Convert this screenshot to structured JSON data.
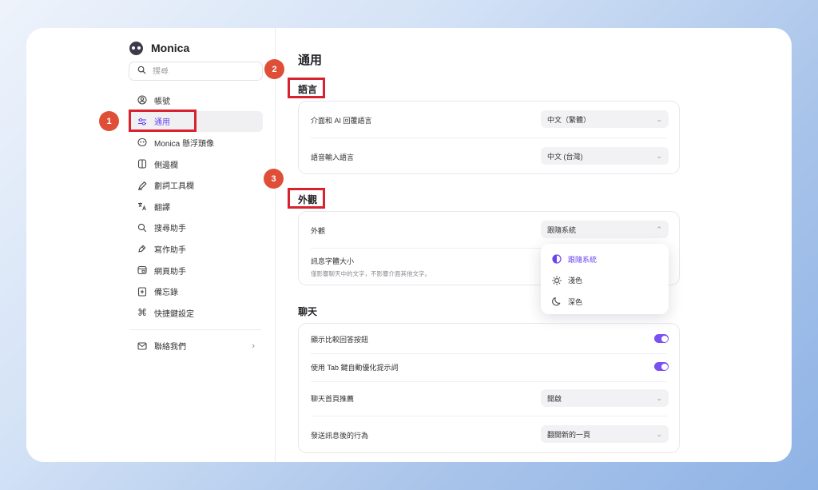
{
  "app": {
    "name": "Monica"
  },
  "search": {
    "placeholder": "搜尋"
  },
  "sidebar": {
    "items": [
      {
        "label": "帳號",
        "icon": "user-circle-icon"
      },
      {
        "label": "通用",
        "icon": "sliders-icon"
      },
      {
        "label": "Monica 懸浮頭像",
        "icon": "monica-face-icon"
      },
      {
        "label": "側邊欄",
        "icon": "sidebar-panel-icon"
      },
      {
        "label": "劃詞工具欄",
        "icon": "highlighter-icon"
      },
      {
        "label": "翻譯",
        "icon": "translate-icon"
      },
      {
        "label": "搜尋助手",
        "icon": "search-icon"
      },
      {
        "label": "寫作助手",
        "icon": "pen-icon"
      },
      {
        "label": "網頁助手",
        "icon": "web-page-icon"
      },
      {
        "label": "備忘錄",
        "icon": "memo-icon"
      },
      {
        "label": "快捷鍵設定",
        "icon": "command-key-icon"
      }
    ],
    "contact": {
      "label": "聯絡我們",
      "icon": "mail-icon"
    },
    "active_index": 1
  },
  "annotations": [
    "1",
    "2",
    "3"
  ],
  "main": {
    "title": "通用",
    "language": {
      "title": "語言",
      "rows": [
        {
          "label": "介面和 AI 回覆語言",
          "value": "中文（繁體）"
        },
        {
          "label": "語音輸入語言",
          "value": "中文 (台灣)"
        }
      ]
    },
    "appearance": {
      "title": "外觀",
      "theme_label": "外觀",
      "theme_value": "跟隨系統",
      "font_label": "訊息字體大小",
      "font_sub": "僅影響聊天中的文字，不影響介面其他文字。",
      "options": [
        {
          "label": "跟隨系統",
          "icon": "half-circle-icon",
          "selected": true
        },
        {
          "label": "淺色",
          "icon": "sun-icon",
          "selected": false
        },
        {
          "label": "深色",
          "icon": "moon-icon",
          "selected": false
        }
      ]
    },
    "chat": {
      "title": "聊天",
      "rows": [
        {
          "label": "顯示比較回答按鈕",
          "type": "toggle",
          "on": true
        },
        {
          "label": "使用 Tab 鍵自動優化提示詞",
          "type": "toggle",
          "on": true
        },
        {
          "label": "聊天首頁推薦",
          "type": "select",
          "value": "開啟"
        },
        {
          "label": "發送訊息後的行為",
          "type": "select",
          "value": "翻開新的一頁"
        }
      ]
    }
  },
  "colors": {
    "accent": "#6b43ee",
    "annotation_red": "#d92231",
    "badge": "#df4e37"
  }
}
